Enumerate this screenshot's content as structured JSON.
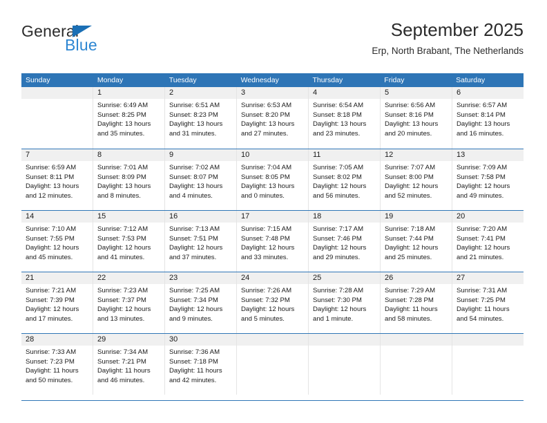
{
  "brand": {
    "name_part1": "General",
    "name_part2": "Blue",
    "color_dark": "#2b2b2b",
    "color_blue": "#2d86d2",
    "triangle_color": "#1a6fb5"
  },
  "header": {
    "title": "September 2025",
    "subtitle": "Erp, North Brabant, The Netherlands"
  },
  "theme": {
    "header_bg": "#2e75b6",
    "header_text": "#ffffff",
    "daynum_bg": "#f0f0f0",
    "grid_line": "#e4e4e4",
    "row_line": "#2e75b6"
  },
  "weekdays": [
    "Sunday",
    "Monday",
    "Tuesday",
    "Wednesday",
    "Thursday",
    "Friday",
    "Saturday"
  ],
  "labels": {
    "sunrise": "Sunrise:",
    "sunset": "Sunset:",
    "daylight": "Daylight:"
  },
  "weeks": [
    [
      {
        "day": "",
        "sunrise": "",
        "sunset": "",
        "daylight_line1": "",
        "daylight_line2": ""
      },
      {
        "day": "1",
        "sunrise": "Sunrise: 6:49 AM",
        "sunset": "Sunset: 8:25 PM",
        "daylight_line1": "Daylight: 13 hours",
        "daylight_line2": "and 35 minutes."
      },
      {
        "day": "2",
        "sunrise": "Sunrise: 6:51 AM",
        "sunset": "Sunset: 8:23 PM",
        "daylight_line1": "Daylight: 13 hours",
        "daylight_line2": "and 31 minutes."
      },
      {
        "day": "3",
        "sunrise": "Sunrise: 6:53 AM",
        "sunset": "Sunset: 8:20 PM",
        "daylight_line1": "Daylight: 13 hours",
        "daylight_line2": "and 27 minutes."
      },
      {
        "day": "4",
        "sunrise": "Sunrise: 6:54 AM",
        "sunset": "Sunset: 8:18 PM",
        "daylight_line1": "Daylight: 13 hours",
        "daylight_line2": "and 23 minutes."
      },
      {
        "day": "5",
        "sunrise": "Sunrise: 6:56 AM",
        "sunset": "Sunset: 8:16 PM",
        "daylight_line1": "Daylight: 13 hours",
        "daylight_line2": "and 20 minutes."
      },
      {
        "day": "6",
        "sunrise": "Sunrise: 6:57 AM",
        "sunset": "Sunset: 8:14 PM",
        "daylight_line1": "Daylight: 13 hours",
        "daylight_line2": "and 16 minutes."
      }
    ],
    [
      {
        "day": "7",
        "sunrise": "Sunrise: 6:59 AM",
        "sunset": "Sunset: 8:11 PM",
        "daylight_line1": "Daylight: 13 hours",
        "daylight_line2": "and 12 minutes."
      },
      {
        "day": "8",
        "sunrise": "Sunrise: 7:01 AM",
        "sunset": "Sunset: 8:09 PM",
        "daylight_line1": "Daylight: 13 hours",
        "daylight_line2": "and 8 minutes."
      },
      {
        "day": "9",
        "sunrise": "Sunrise: 7:02 AM",
        "sunset": "Sunset: 8:07 PM",
        "daylight_line1": "Daylight: 13 hours",
        "daylight_line2": "and 4 minutes."
      },
      {
        "day": "10",
        "sunrise": "Sunrise: 7:04 AM",
        "sunset": "Sunset: 8:05 PM",
        "daylight_line1": "Daylight: 13 hours",
        "daylight_line2": "and 0 minutes."
      },
      {
        "day": "11",
        "sunrise": "Sunrise: 7:05 AM",
        "sunset": "Sunset: 8:02 PM",
        "daylight_line1": "Daylight: 12 hours",
        "daylight_line2": "and 56 minutes."
      },
      {
        "day": "12",
        "sunrise": "Sunrise: 7:07 AM",
        "sunset": "Sunset: 8:00 PM",
        "daylight_line1": "Daylight: 12 hours",
        "daylight_line2": "and 52 minutes."
      },
      {
        "day": "13",
        "sunrise": "Sunrise: 7:09 AM",
        "sunset": "Sunset: 7:58 PM",
        "daylight_line1": "Daylight: 12 hours",
        "daylight_line2": "and 49 minutes."
      }
    ],
    [
      {
        "day": "14",
        "sunrise": "Sunrise: 7:10 AM",
        "sunset": "Sunset: 7:55 PM",
        "daylight_line1": "Daylight: 12 hours",
        "daylight_line2": "and 45 minutes."
      },
      {
        "day": "15",
        "sunrise": "Sunrise: 7:12 AM",
        "sunset": "Sunset: 7:53 PM",
        "daylight_line1": "Daylight: 12 hours",
        "daylight_line2": "and 41 minutes."
      },
      {
        "day": "16",
        "sunrise": "Sunrise: 7:13 AM",
        "sunset": "Sunset: 7:51 PM",
        "daylight_line1": "Daylight: 12 hours",
        "daylight_line2": "and 37 minutes."
      },
      {
        "day": "17",
        "sunrise": "Sunrise: 7:15 AM",
        "sunset": "Sunset: 7:48 PM",
        "daylight_line1": "Daylight: 12 hours",
        "daylight_line2": "and 33 minutes."
      },
      {
        "day": "18",
        "sunrise": "Sunrise: 7:17 AM",
        "sunset": "Sunset: 7:46 PM",
        "daylight_line1": "Daylight: 12 hours",
        "daylight_line2": "and 29 minutes."
      },
      {
        "day": "19",
        "sunrise": "Sunrise: 7:18 AM",
        "sunset": "Sunset: 7:44 PM",
        "daylight_line1": "Daylight: 12 hours",
        "daylight_line2": "and 25 minutes."
      },
      {
        "day": "20",
        "sunrise": "Sunrise: 7:20 AM",
        "sunset": "Sunset: 7:41 PM",
        "daylight_line1": "Daylight: 12 hours",
        "daylight_line2": "and 21 minutes."
      }
    ],
    [
      {
        "day": "21",
        "sunrise": "Sunrise: 7:21 AM",
        "sunset": "Sunset: 7:39 PM",
        "daylight_line1": "Daylight: 12 hours",
        "daylight_line2": "and 17 minutes."
      },
      {
        "day": "22",
        "sunrise": "Sunrise: 7:23 AM",
        "sunset": "Sunset: 7:37 PM",
        "daylight_line1": "Daylight: 12 hours",
        "daylight_line2": "and 13 minutes."
      },
      {
        "day": "23",
        "sunrise": "Sunrise: 7:25 AM",
        "sunset": "Sunset: 7:34 PM",
        "daylight_line1": "Daylight: 12 hours",
        "daylight_line2": "and 9 minutes."
      },
      {
        "day": "24",
        "sunrise": "Sunrise: 7:26 AM",
        "sunset": "Sunset: 7:32 PM",
        "daylight_line1": "Daylight: 12 hours",
        "daylight_line2": "and 5 minutes."
      },
      {
        "day": "25",
        "sunrise": "Sunrise: 7:28 AM",
        "sunset": "Sunset: 7:30 PM",
        "daylight_line1": "Daylight: 12 hours",
        "daylight_line2": "and 1 minute."
      },
      {
        "day": "26",
        "sunrise": "Sunrise: 7:29 AM",
        "sunset": "Sunset: 7:28 PM",
        "daylight_line1": "Daylight: 11 hours",
        "daylight_line2": "and 58 minutes."
      },
      {
        "day": "27",
        "sunrise": "Sunrise: 7:31 AM",
        "sunset": "Sunset: 7:25 PM",
        "daylight_line1": "Daylight: 11 hours",
        "daylight_line2": "and 54 minutes."
      }
    ],
    [
      {
        "day": "28",
        "sunrise": "Sunrise: 7:33 AM",
        "sunset": "Sunset: 7:23 PM",
        "daylight_line1": "Daylight: 11 hours",
        "daylight_line2": "and 50 minutes."
      },
      {
        "day": "29",
        "sunrise": "Sunrise: 7:34 AM",
        "sunset": "Sunset: 7:21 PM",
        "daylight_line1": "Daylight: 11 hours",
        "daylight_line2": "and 46 minutes."
      },
      {
        "day": "30",
        "sunrise": "Sunrise: 7:36 AM",
        "sunset": "Sunset: 7:18 PM",
        "daylight_line1": "Daylight: 11 hours",
        "daylight_line2": "and 42 minutes."
      },
      {
        "day": "",
        "sunrise": "",
        "sunset": "",
        "daylight_line1": "",
        "daylight_line2": ""
      },
      {
        "day": "",
        "sunrise": "",
        "sunset": "",
        "daylight_line1": "",
        "daylight_line2": ""
      },
      {
        "day": "",
        "sunrise": "",
        "sunset": "",
        "daylight_line1": "",
        "daylight_line2": ""
      },
      {
        "day": "",
        "sunrise": "",
        "sunset": "",
        "daylight_line1": "",
        "daylight_line2": ""
      }
    ]
  ]
}
